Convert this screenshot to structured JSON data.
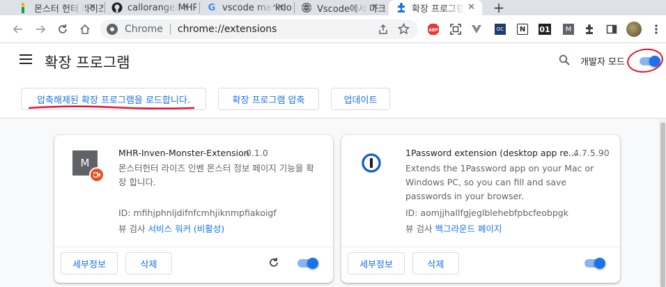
{
  "tabs": [
    {
      "title": "몬스터 헌터 라이즈",
      "favicon": "page-icon"
    },
    {
      "title": "callorange/MHR-Inven",
      "favicon": "github-icon"
    },
    {
      "title": "vscode markdown",
      "favicon": "google-icon"
    },
    {
      "title": "Vscode에서 마크다운",
      "favicon": "globe-icon"
    },
    {
      "title": "확장 프로그램",
      "favicon": "puzzle-icon",
      "active": true
    }
  ],
  "new_tab_label": "+",
  "omnibox": {
    "origin": "Chrome",
    "url": "chrome://extensions"
  },
  "toolbar_extensions": [
    {
      "name": "adblock-icon",
      "label": "ABP",
      "color": "#e53935"
    },
    {
      "name": "screenshot-icon",
      "label": ""
    },
    {
      "name": "vue-devtools-icon",
      "label": ""
    },
    {
      "name": "oc-extension-icon",
      "label": "OC",
      "color": "#1e3a6e"
    },
    {
      "name": "notion-icon",
      "label": "N"
    },
    {
      "name": "extension-01-icon",
      "label": "01"
    },
    {
      "name": "m-extension-icon",
      "label": "M"
    }
  ],
  "header": {
    "title": "확장 프로그램",
    "devmode_label": "개발자 모드",
    "devmode_on": true
  },
  "actions": {
    "load_unpacked": "압축해제된 확장 프로그램을 로드합니다.",
    "pack": "확장 프로그램 압축",
    "update": "업데이트"
  },
  "extensions": [
    {
      "name": "MHR-Inven-Monster-Extension",
      "version": "0.1.0",
      "description": "몬스터헌터 라이즈 인벤 몬스터 정보 페이지 기능을 확장 합니다.",
      "id": "ID: mfihjphnljdifnfcmhjiknmpfiakoigf",
      "inspect_prefix": "뷰 검사",
      "inspect_link": "서비스 워커 (비활성)",
      "icon_letter": "M",
      "details": "세부정보",
      "remove": "삭제",
      "enabled": true
    },
    {
      "name": "1Password extension (desktop app re...",
      "version": "4.7.5.90",
      "description": "Extends the 1Password app on your Mac or Windows PC, so you can fill and save passwords in your browser.",
      "id": "ID: aomjjhallfgjeglblehebfpbcfeobpgk",
      "inspect_prefix": "뷰 검사",
      "inspect_link": "백그라운드 페이지",
      "details": "세부정보",
      "remove": "삭제",
      "enabled": true
    }
  ],
  "colors": {
    "accent": "#1a73e8",
    "annotation": "#e8112d"
  }
}
